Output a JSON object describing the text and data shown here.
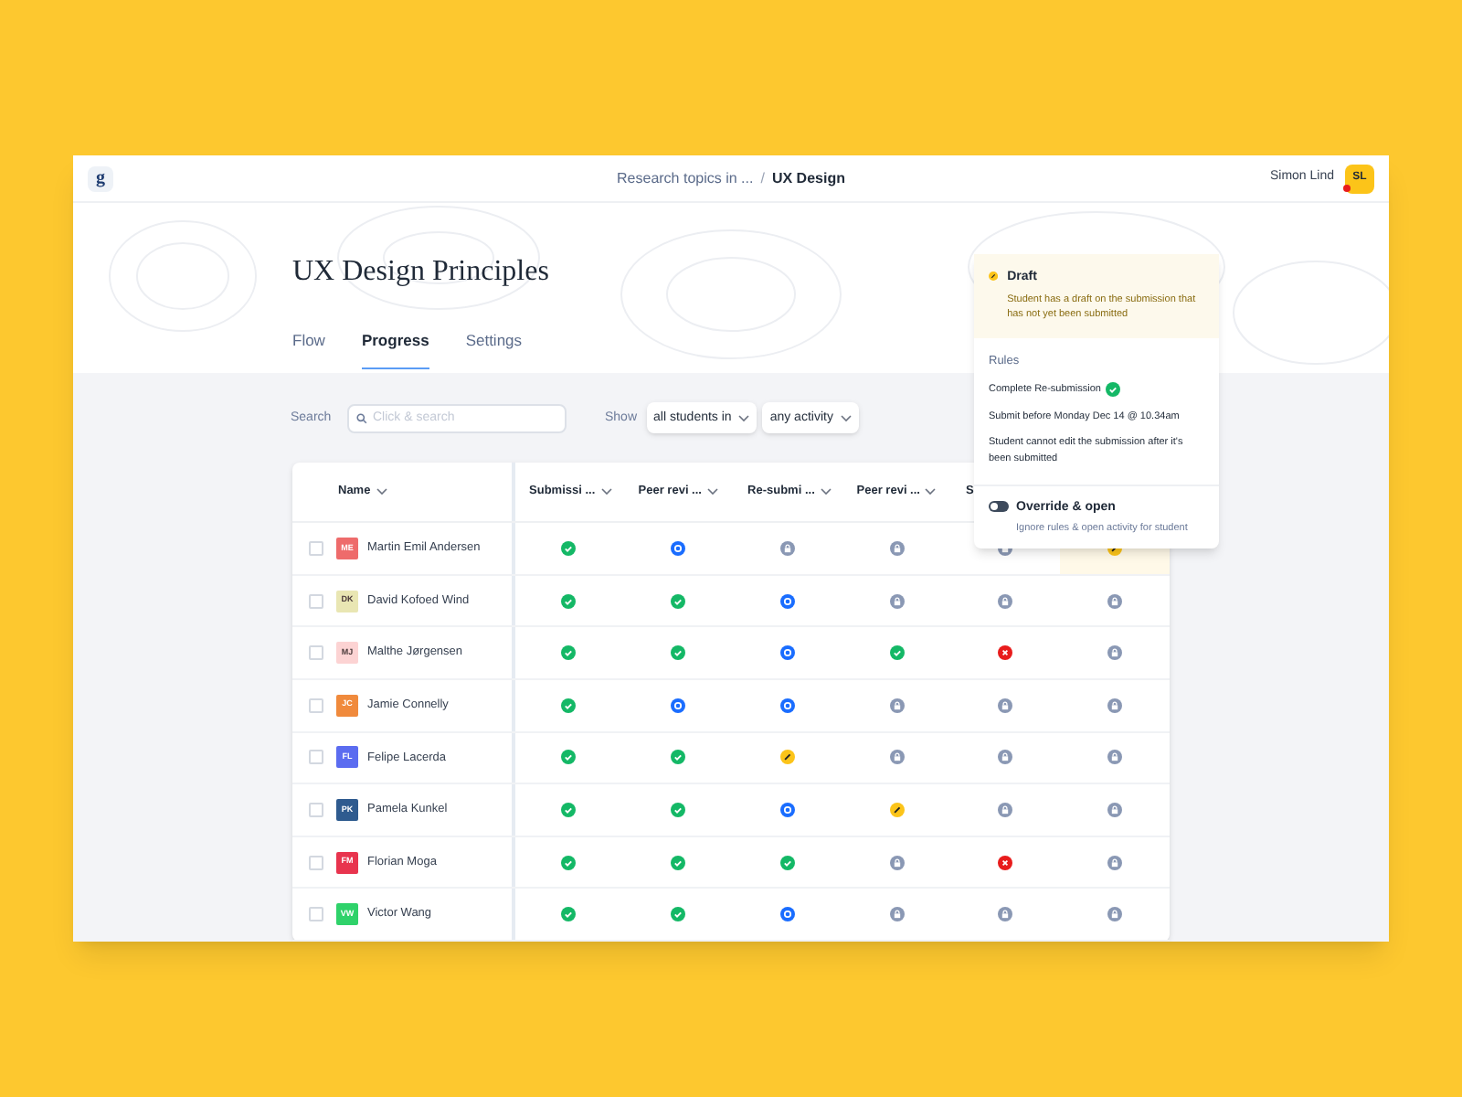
{
  "header": {
    "logo": "g",
    "breadcrumb": [
      "Research topics in ...",
      "UX Design"
    ],
    "separator": "/",
    "user": {
      "name": "Simon Lind",
      "initials": "SL",
      "notification": true
    }
  },
  "page": {
    "title": "UX Design Principles",
    "tabs": [
      {
        "label": "Flow",
        "selected": false
      },
      {
        "label": "Progress",
        "selected": true
      },
      {
        "label": "Settings",
        "selected": false
      }
    ]
  },
  "filters": {
    "search_label": "Search",
    "search": {
      "placeholder": "Click & search"
    },
    "show_label": "Show",
    "dropdowns": [
      "all students in",
      "any activity"
    ]
  },
  "table": {
    "name_column": "Name",
    "columns": [
      "Submissi ...",
      "Peer revi ...",
      "Re-submi ...",
      "Peer revi ...",
      "S"
    ],
    "rows": [
      {
        "initials": "ME",
        "name": "Martin Emil Andersen",
        "color": "#ee6b6b",
        "checked": false,
        "cells": [
          {
            "kind": "done",
            "selected": false
          },
          {
            "kind": "open",
            "selected": false
          },
          {
            "kind": "locked",
            "selected": false
          },
          {
            "kind": "locked",
            "selected": false
          },
          {
            "kind": "locked",
            "selected": false
          },
          {
            "kind": "draft",
            "selected": true
          }
        ]
      },
      {
        "initials": "DK",
        "name": "David Kofoed Wind",
        "color": "#e9e6b3",
        "checked": false,
        "cells": [
          {
            "kind": "done",
            "selected": false
          },
          {
            "kind": "done",
            "selected": false
          },
          {
            "kind": "open",
            "selected": false
          },
          {
            "kind": "locked",
            "selected": false
          },
          {
            "kind": "locked",
            "selected": false
          },
          {
            "kind": "locked",
            "selected": false
          }
        ]
      },
      {
        "initials": "MJ",
        "name": "Malthe Jørgensen",
        "color": "#fcd3d3",
        "checked": false,
        "cells": [
          {
            "kind": "done",
            "selected": false
          },
          {
            "kind": "done",
            "selected": false
          },
          {
            "kind": "open",
            "selected": false
          },
          {
            "kind": "done",
            "selected": false
          },
          {
            "kind": "failed",
            "selected": false
          },
          {
            "kind": "locked",
            "selected": false
          }
        ]
      },
      {
        "initials": "JC",
        "name": "Jamie Connelly",
        "color": "#f08a3c",
        "checked": false,
        "cells": [
          {
            "kind": "done",
            "selected": false
          },
          {
            "kind": "open",
            "selected": false
          },
          {
            "kind": "open",
            "selected": false
          },
          {
            "kind": "locked",
            "selected": false
          },
          {
            "kind": "locked",
            "selected": false
          },
          {
            "kind": "locked",
            "selected": false
          }
        ]
      },
      {
        "initials": "FL",
        "name": "Felipe Lacerda",
        "color": "#5b6cf0",
        "checked": false,
        "cells": [
          {
            "kind": "done",
            "selected": false
          },
          {
            "kind": "done",
            "selected": false
          },
          {
            "kind": "draft",
            "selected": false
          },
          {
            "kind": "locked",
            "selected": false
          },
          {
            "kind": "locked",
            "selected": false
          },
          {
            "kind": "locked",
            "selected": false
          }
        ]
      },
      {
        "initials": "PK",
        "name": "Pamela Kunkel",
        "color": "#2f5b8f",
        "checked": false,
        "cells": [
          {
            "kind": "done",
            "selected": false
          },
          {
            "kind": "done",
            "selected": false
          },
          {
            "kind": "open",
            "selected": false
          },
          {
            "kind": "draft",
            "selected": false
          },
          {
            "kind": "locked",
            "selected": false
          },
          {
            "kind": "locked",
            "selected": false
          }
        ]
      },
      {
        "initials": "FM",
        "name": "Florian Moga",
        "color": "#e8344e",
        "checked": false,
        "cells": [
          {
            "kind": "done",
            "selected": false
          },
          {
            "kind": "done",
            "selected": false
          },
          {
            "kind": "done",
            "selected": false
          },
          {
            "kind": "locked",
            "selected": false
          },
          {
            "kind": "failed",
            "selected": false
          },
          {
            "kind": "locked",
            "selected": false
          }
        ]
      },
      {
        "initials": "VW",
        "name": "Victor Wang",
        "color": "#2fd26a",
        "checked": false,
        "cells": [
          {
            "kind": "done",
            "selected": false
          },
          {
            "kind": "done",
            "selected": false
          },
          {
            "kind": "open",
            "selected": false
          },
          {
            "kind": "locked",
            "selected": false
          },
          {
            "kind": "locked",
            "selected": false
          },
          {
            "kind": "locked",
            "selected": false
          }
        ]
      }
    ]
  },
  "popover": {
    "status": {
      "kind": "draft",
      "title": "Draft",
      "text": "Student has a draft on the submission that has not yet been submitted"
    },
    "rules_title": "Rules",
    "rules": [
      {
        "text": "Complete Re-submission",
        "done": true
      },
      {
        "text": "Submit before Monday Dec 14 @ 10.34am",
        "done": false
      },
      {
        "text": "Student cannot edit the submission after it's been submitted",
        "done": false
      }
    ],
    "override": {
      "title": "Override & open",
      "text": "Ignore rules & open activity for student",
      "on": false
    }
  }
}
